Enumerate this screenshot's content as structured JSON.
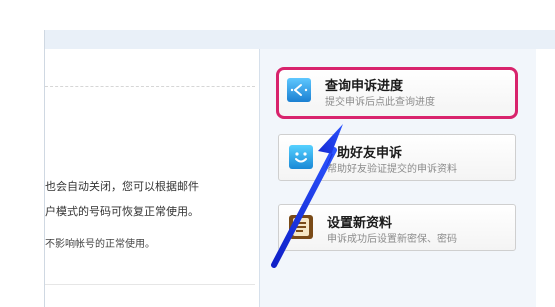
{
  "left_text": {
    "line1": "也会自动关闭，您可以根据邮件",
    "line2": "户模式的号码可恢复正常使用。",
    "line3": "不影响帐号的正常使用。"
  },
  "options": [
    {
      "title": "查询申诉进度",
      "subtitle": "提交申诉后点此查询进度",
      "icon": "clock-icon",
      "selected": true
    },
    {
      "title": "邀请好友辅助申诉",
      "title_visible": "助好友申诉",
      "subtitle": "帮助好友验证提交的申诉资料",
      "icon": "smiley-icon"
    },
    {
      "title": "设置新资料",
      "subtitle": "申诉成功后设置新密保、密码",
      "icon": "notepad-icon"
    }
  ],
  "colors": {
    "selection_border": "#d8236c",
    "arrow": "#1b2fd0",
    "panel_bg": "#f2f6fb",
    "topbar_bg": "#e9f0f8"
  }
}
